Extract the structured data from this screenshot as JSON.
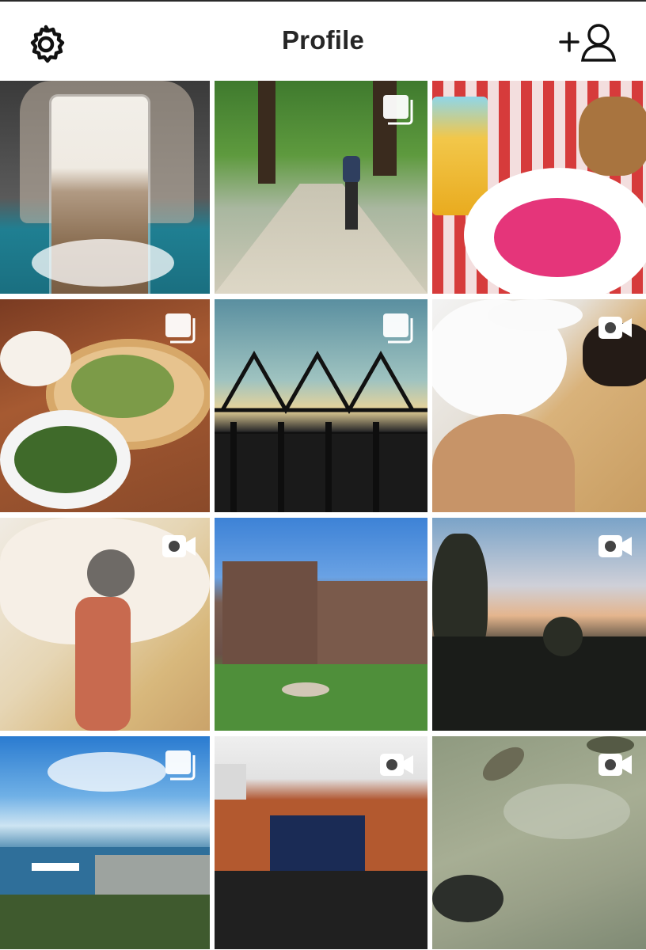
{
  "header": {
    "title": "Profile",
    "left_icon": "gear-icon",
    "right_icon": "add-person-icon"
  },
  "colors": {
    "header_text": "#262626",
    "icon": "#111111",
    "badge": "#ffffff"
  },
  "grid": {
    "columns": 3,
    "tiles": [
      {
        "scene": "latte",
        "badge": "none"
      },
      {
        "scene": "cycling-path",
        "badge": "multiple-photos-icon"
      },
      {
        "scene": "beer-and-soup",
        "badge": "none"
      },
      {
        "scene": "pizza-and-salad",
        "badge": "multiple-photos-icon"
      },
      {
        "scene": "bridge-sunset",
        "badge": "multiple-photos-icon"
      },
      {
        "scene": "dog-closeup",
        "badge": "video-camera-icon"
      },
      {
        "scene": "dog-hand",
        "badge": "video-camera-icon"
      },
      {
        "scene": "campus-building",
        "badge": "none"
      },
      {
        "scene": "trees-sunset",
        "badge": "video-camera-icon"
      },
      {
        "scene": "coastal-city",
        "badge": "multiple-photos-icon"
      },
      {
        "scene": "outdoor-concert",
        "badge": "video-camera-icon"
      },
      {
        "scene": "turtles-water",
        "badge": "video-camera-icon"
      }
    ]
  }
}
